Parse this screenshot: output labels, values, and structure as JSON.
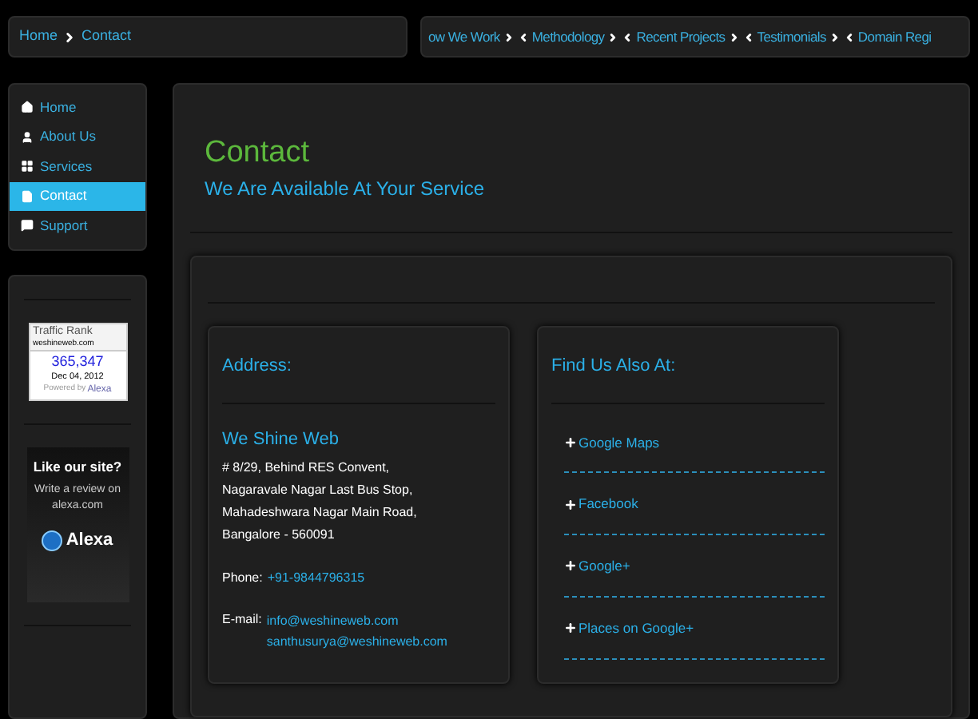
{
  "breadcrumb": {
    "items": [
      "Home",
      "Contact"
    ]
  },
  "top_nav": [
    "ow We Work",
    "Methodology",
    "Recent Projects",
    "Testimonials",
    "Domain Regi"
  ],
  "sidebar": {
    "items": [
      {
        "label": "Home",
        "kind": "home",
        "selected": false
      },
      {
        "label": "About Us",
        "kind": "user",
        "selected": false
      },
      {
        "label": "Services",
        "kind": "grid",
        "selected": false
      },
      {
        "label": "Contact",
        "kind": "page",
        "selected": true
      },
      {
        "label": "Support",
        "kind": "comment",
        "selected": false
      }
    ]
  },
  "rank_widget": {
    "title": "Traffic Rank",
    "site": "weshineweb.com",
    "rank": "365,347",
    "date": "Dec 04, 2012",
    "powered_by": "Powered by",
    "brand": "Alexa"
  },
  "review_widget": {
    "title": "Like our site?",
    "text": "Write a review on alexa.com",
    "brand": "Alexa"
  },
  "page": {
    "title": "Contact",
    "subtitle": "We Are Available At Your Service"
  },
  "address": {
    "heading": "Address:",
    "company": "We Shine Web",
    "lines": [
      "# 8/29, Behind RES Convent,",
      "Nagaravale Nagar Last Bus Stop,",
      "Mahadeshwara Nagar Main Road,",
      "Bangalore - 560091"
    ],
    "phone_label": "Phone:",
    "phone": "+91-9844796315",
    "email_label": "E-mail:",
    "emails": [
      "info@weshineweb.com",
      "santhusurya@weshineweb.com"
    ]
  },
  "find_us": {
    "heading": "Find Us Also At:",
    "links": [
      "Google Maps",
      "Facebook",
      "Google+",
      "Places on Google+"
    ]
  }
}
